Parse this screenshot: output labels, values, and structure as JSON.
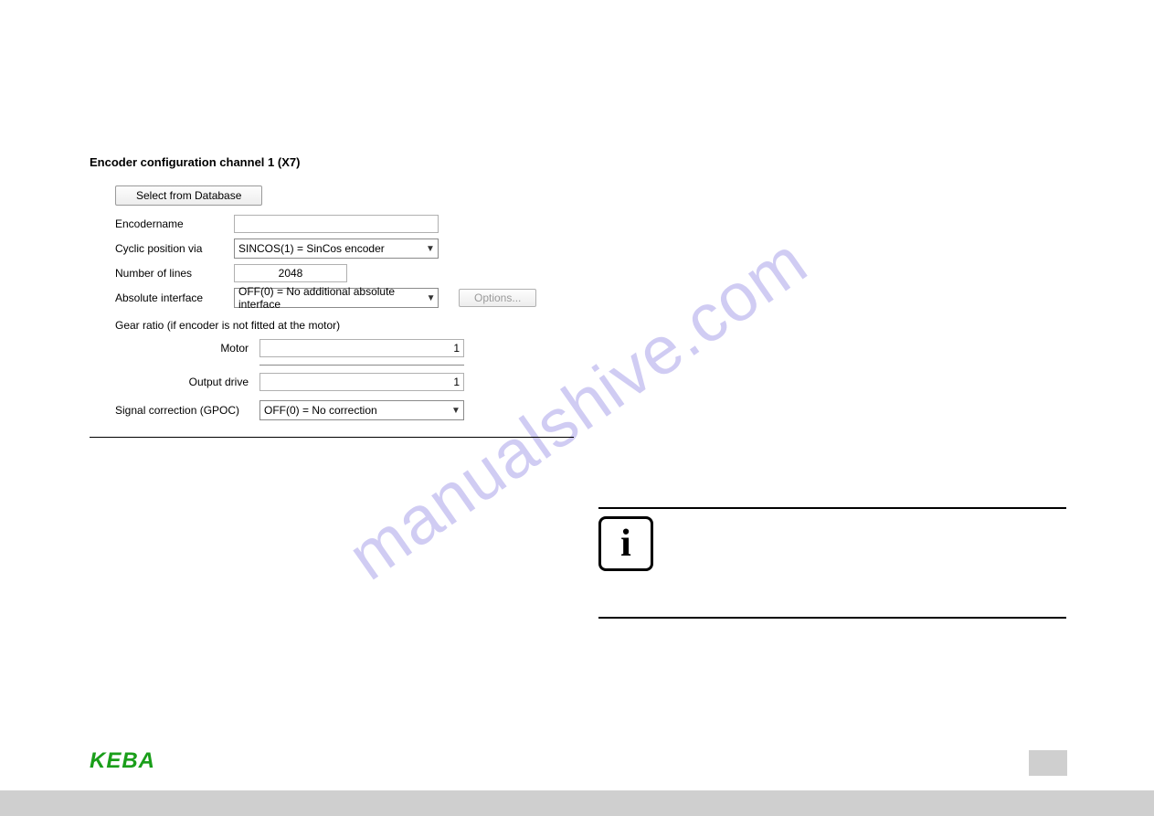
{
  "watermark": "manualshive.com",
  "form": {
    "title": "Encoder configuration channel 1 (X7)",
    "select_db_btn": "Select from Database",
    "labels": {
      "encodername": "Encodername",
      "cyclic_position": "Cyclic position via",
      "number_of_lines": "Number of lines",
      "absolute_interface": "Absolute interface",
      "gear_ratio_heading": "Gear ratio (if encoder is not fitted at the motor)",
      "motor": "Motor",
      "output_drive": "Output drive",
      "signal_correction": "Signal correction (GPOC)"
    },
    "values": {
      "encodername": "",
      "cyclic_position": "SINCOS(1) = SinCos encoder",
      "number_of_lines": "2048",
      "absolute_interface": "OFF(0) = No additional absolute interface",
      "options_btn": "Options...",
      "motor": "1",
      "output_drive": "1",
      "signal_correction": "OFF(0) = No correction"
    }
  },
  "info_icon_letter": "i",
  "footer": {
    "logo_text": "KEBA"
  }
}
